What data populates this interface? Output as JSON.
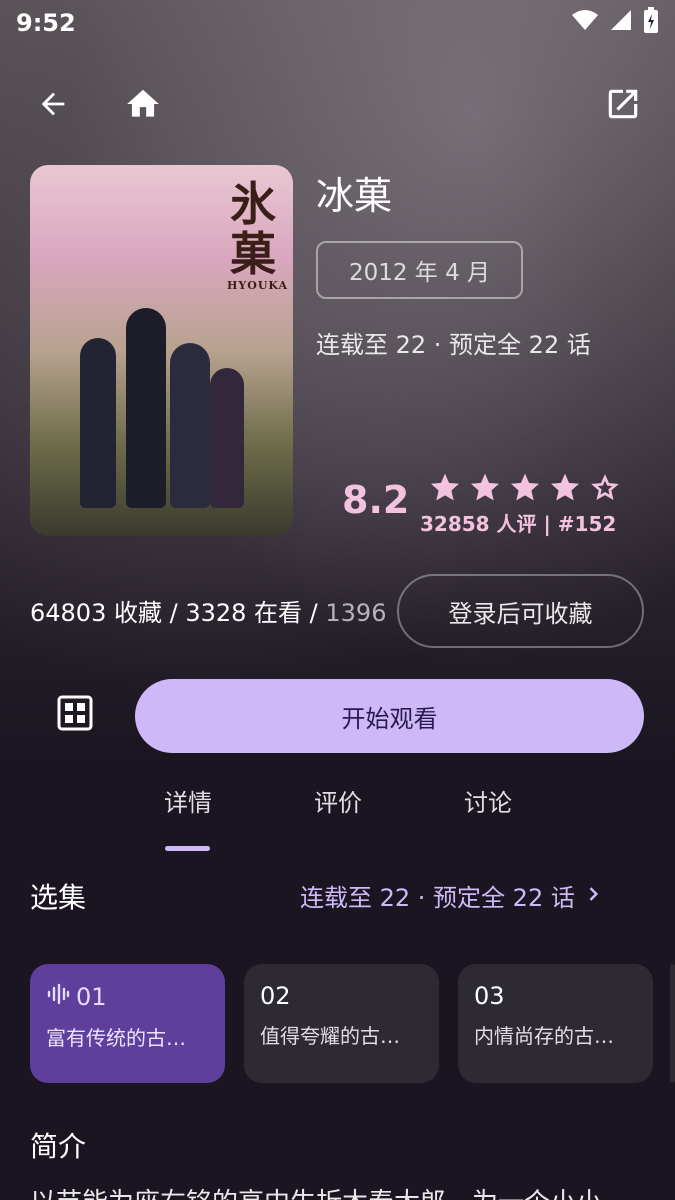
{
  "status_bar": {
    "time": "9:52"
  },
  "toolbar": {
    "back": "back-arrow",
    "home": "home",
    "open_external": "open-in-new"
  },
  "anime": {
    "title": "冰菓",
    "poster_art_title": "氷菓",
    "poster_art_sub": "HYOUKA",
    "air_date": "2012 年 4 月",
    "serial_info": "连载至 22 · 预定全 22 话",
    "score": "8.2",
    "star_rating": 4.5,
    "rating_sub": "32858 人评 | #152"
  },
  "collection": {
    "counts_bright": "64803 收藏 / 3328 在看 /",
    "counts_dim": " 1396",
    "login_button": "登录后可收藏"
  },
  "actions": {
    "watch_button": "开始观看"
  },
  "tabs": [
    {
      "label": "详情",
      "active": true
    },
    {
      "label": "评价",
      "active": false
    },
    {
      "label": "讨论",
      "active": false
    }
  ],
  "episodes_section": {
    "title": "选集",
    "link_text": "连载至 22 · 预定全 22 话",
    "episodes": [
      {
        "num": "01",
        "name": "富有传统的古…",
        "active": true
      },
      {
        "num": "02",
        "name": "值得夸耀的古…",
        "active": false
      },
      {
        "num": "03",
        "name": "内情尚存的古…",
        "active": false
      }
    ]
  },
  "synopsis_section": {
    "title": "简介",
    "text_preview": "以节能为座右铭的高中生折木奉太郎，为一个小小"
  },
  "colors": {
    "accent": "#cdb9f8",
    "pink": "#f2c2de",
    "active_ep": "#5e3f9c",
    "bg": "#1a1520"
  }
}
